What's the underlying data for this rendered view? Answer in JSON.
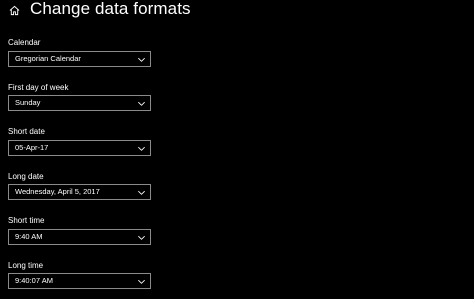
{
  "header": {
    "title": "Change data formats",
    "home_icon": "home-icon"
  },
  "fields": [
    {
      "label": "Calendar",
      "value": "Gregorian Calendar"
    },
    {
      "label": "First day of week",
      "value": "Sunday"
    },
    {
      "label": "Short date",
      "value": "05-Apr-17"
    },
    {
      "label": "Long date",
      "value": "Wednesday, April 5, 2017"
    },
    {
      "label": "Short time",
      "value": "9:40 AM"
    },
    {
      "label": "Long time",
      "value": "9:40:07 AM"
    }
  ]
}
